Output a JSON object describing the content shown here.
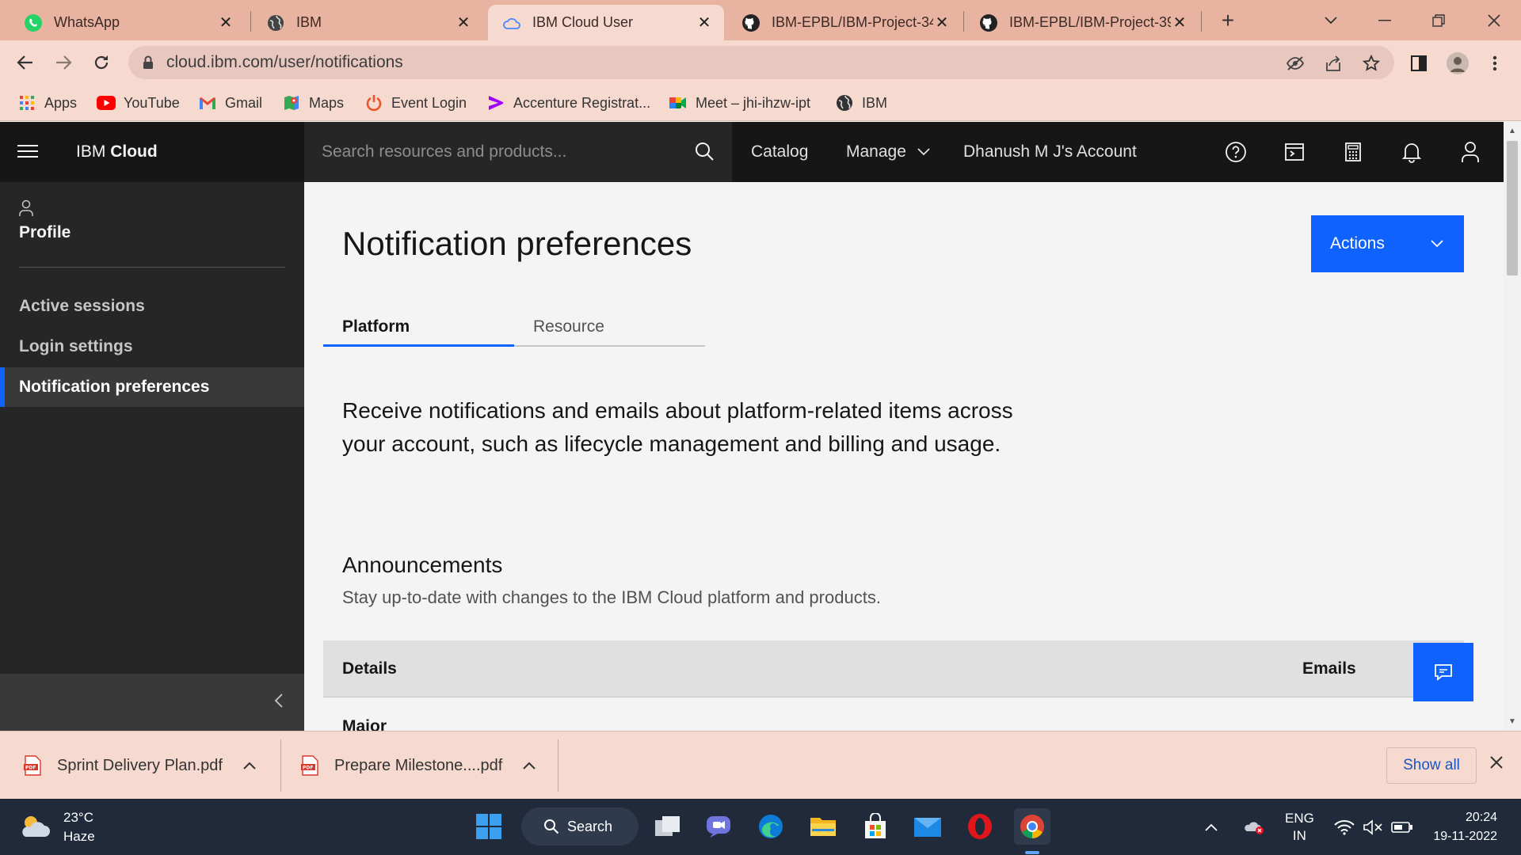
{
  "browser": {
    "tabs": [
      {
        "title": "WhatsApp",
        "icon": "whatsapp-icon"
      },
      {
        "title": "IBM",
        "icon": "globe-icon"
      },
      {
        "title": "IBM Cloud User",
        "icon": "cloud-icon",
        "active": true
      },
      {
        "title": "IBM-EPBL/IBM-Project-34",
        "icon": "github-icon"
      },
      {
        "title": "IBM-EPBL/IBM-Project-39",
        "icon": "github-icon"
      }
    ],
    "new_tab": "+",
    "url": "cloud.ibm.com/user/notifications",
    "bookmarks": [
      {
        "label": "Apps",
        "icon": "apps-grid-icon"
      },
      {
        "label": "YouTube",
        "icon": "youtube-icon"
      },
      {
        "label": "Gmail",
        "icon": "gmail-icon"
      },
      {
        "label": "Maps",
        "icon": "maps-icon"
      },
      {
        "label": "Event Login",
        "icon": "power-icon"
      },
      {
        "label": "Accenture Registrat...",
        "icon": "accenture-icon"
      },
      {
        "label": "Meet – jhi-ihzw-ipt",
        "icon": "meet-icon"
      },
      {
        "label": "IBM",
        "icon": "globe-icon"
      }
    ]
  },
  "header": {
    "brand_prefix": "IBM",
    "brand_name": "Cloud",
    "search_placeholder": "Search resources and products...",
    "catalog": "Catalog",
    "manage": "Manage",
    "account": "Dhanush M J's Account"
  },
  "sidebar": {
    "profile": "Profile",
    "items": [
      {
        "label": "Active sessions"
      },
      {
        "label": "Login settings"
      },
      {
        "label": "Notification preferences",
        "active": true
      }
    ]
  },
  "main": {
    "title": "Notification preferences",
    "actions": "Actions",
    "tabs": [
      {
        "label": "Platform",
        "active": true
      },
      {
        "label": "Resource"
      }
    ],
    "intro": "Receive notifications and emails about platform-related items across your account, such as lifecycle management and billing and usage.",
    "section_title": "Announcements",
    "section_desc": "Stay up-to-date with changes to the IBM Cloud platform and products.",
    "table": {
      "col_details": "Details",
      "col_emails": "Emails",
      "first_row": "Major"
    }
  },
  "downloads": {
    "items": [
      {
        "name": "Sprint Delivery Plan.pdf"
      },
      {
        "name": "Prepare Milestone....pdf"
      }
    ],
    "show_all": "Show all"
  },
  "taskbar": {
    "temperature": "23°C",
    "weather": "Haze",
    "search": "Search",
    "lang_top": "ENG",
    "lang_bottom": "IN",
    "time": "20:24",
    "date": "19-11-2022"
  },
  "colors": {
    "tab_strip": "#e9b3a2",
    "toolbar": "#f6d9cf",
    "ibm_blue": "#0f62fe",
    "header_bg": "#161616",
    "sidebar_bg": "#262626"
  }
}
